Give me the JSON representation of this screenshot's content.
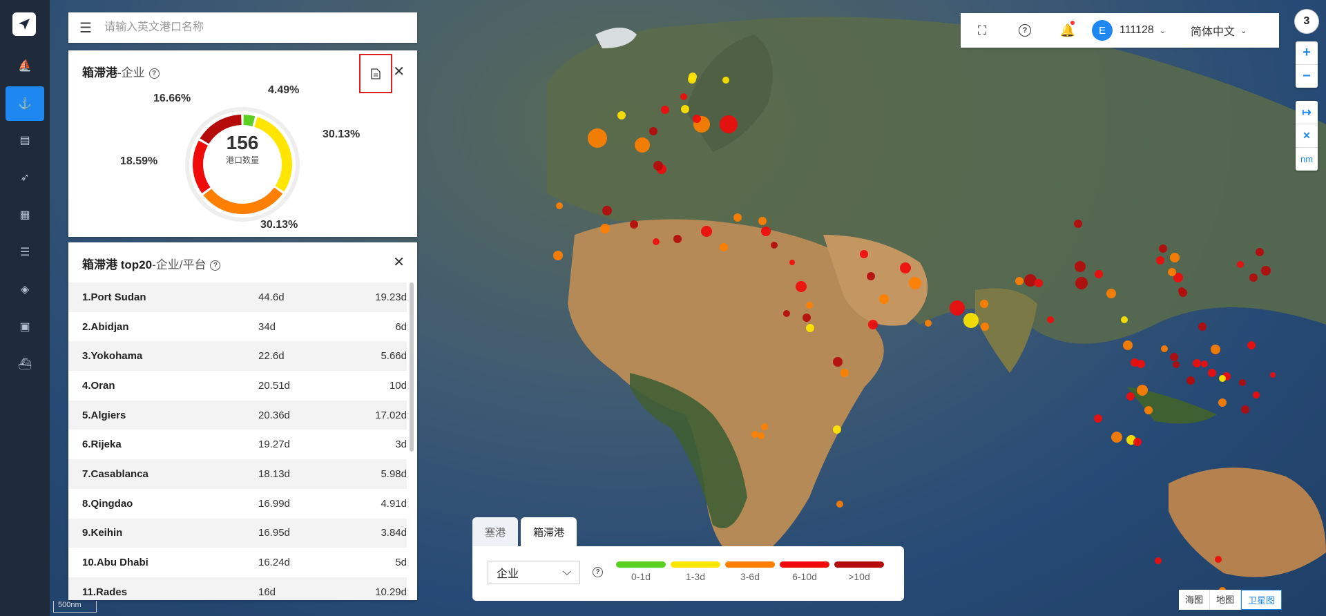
{
  "search": {
    "placeholder": "请输入英文港口名称"
  },
  "donut_panel": {
    "title": "箱滞港",
    "subtitle": "-企业",
    "center_value": "156",
    "center_label": "港口数量",
    "segments": [
      {
        "label": "4.49%",
        "value": 4.49,
        "color": "#5ad122"
      },
      {
        "label": "30.13%",
        "value": 30.13,
        "color": "#ffe500"
      },
      {
        "label": "30.13%",
        "value": 30.13,
        "color": "#ff7f00"
      },
      {
        "label": "18.59%",
        "value": 18.59,
        "color": "#f00b0b"
      },
      {
        "label": "16.66%",
        "value": 16.66,
        "color": "#b50b0b"
      }
    ]
  },
  "top20_panel": {
    "title": "箱滞港 top20",
    "subtitle": "-企业/平台",
    "rows": [
      {
        "name": "1.Port Sudan",
        "v1": "44.6d",
        "v2": "19.23d"
      },
      {
        "name": "2.Abidjan",
        "v1": "34d",
        "v2": "6d"
      },
      {
        "name": "3.Yokohama",
        "v1": "22.6d",
        "v2": "5.66d"
      },
      {
        "name": "4.Oran",
        "v1": "20.51d",
        "v2": "10d"
      },
      {
        "name": "5.Algiers",
        "v1": "20.36d",
        "v2": "17.02d"
      },
      {
        "name": "6.Rijeka",
        "v1": "19.27d",
        "v2": "3d"
      },
      {
        "name": "7.Casablanca",
        "v1": "18.13d",
        "v2": "5.98d"
      },
      {
        "name": "8.Qingdao",
        "v1": "16.99d",
        "v2": "4.91d"
      },
      {
        "name": "9.Keihin",
        "v1": "16.95d",
        "v2": "3.84d"
      },
      {
        "name": "10.Abu Dhabi",
        "v1": "16.24d",
        "v2": "5d"
      },
      {
        "name": "11.Rades",
        "v1": "16d",
        "v2": "10.29d"
      }
    ]
  },
  "toolbar": {
    "user_id": "111128",
    "avatar_letter": "E",
    "language": "简体中文"
  },
  "badge_count": "3",
  "zoom": {
    "plus": "+",
    "minus": "−",
    "measure": "↦",
    "clear": "✕",
    "unit": "nm"
  },
  "tabs": [
    {
      "label": "塞港"
    },
    {
      "label": "箱滞港"
    }
  ],
  "legend": {
    "select_value": "企业",
    "items": [
      {
        "label": "0-1d",
        "color": "#5ad122"
      },
      {
        "label": "1-3d",
        "color": "#ffe500"
      },
      {
        "label": "3-6d",
        "color": "#ff7f00"
      },
      {
        "label": "6-10d",
        "color": "#f00b0b"
      },
      {
        "label": ">10d",
        "color": "#b50b0b"
      }
    ]
  },
  "scale_label": "500nm",
  "map_types": [
    {
      "label": "海图"
    },
    {
      "label": "地图"
    },
    {
      "label": "卫星图"
    }
  ]
}
